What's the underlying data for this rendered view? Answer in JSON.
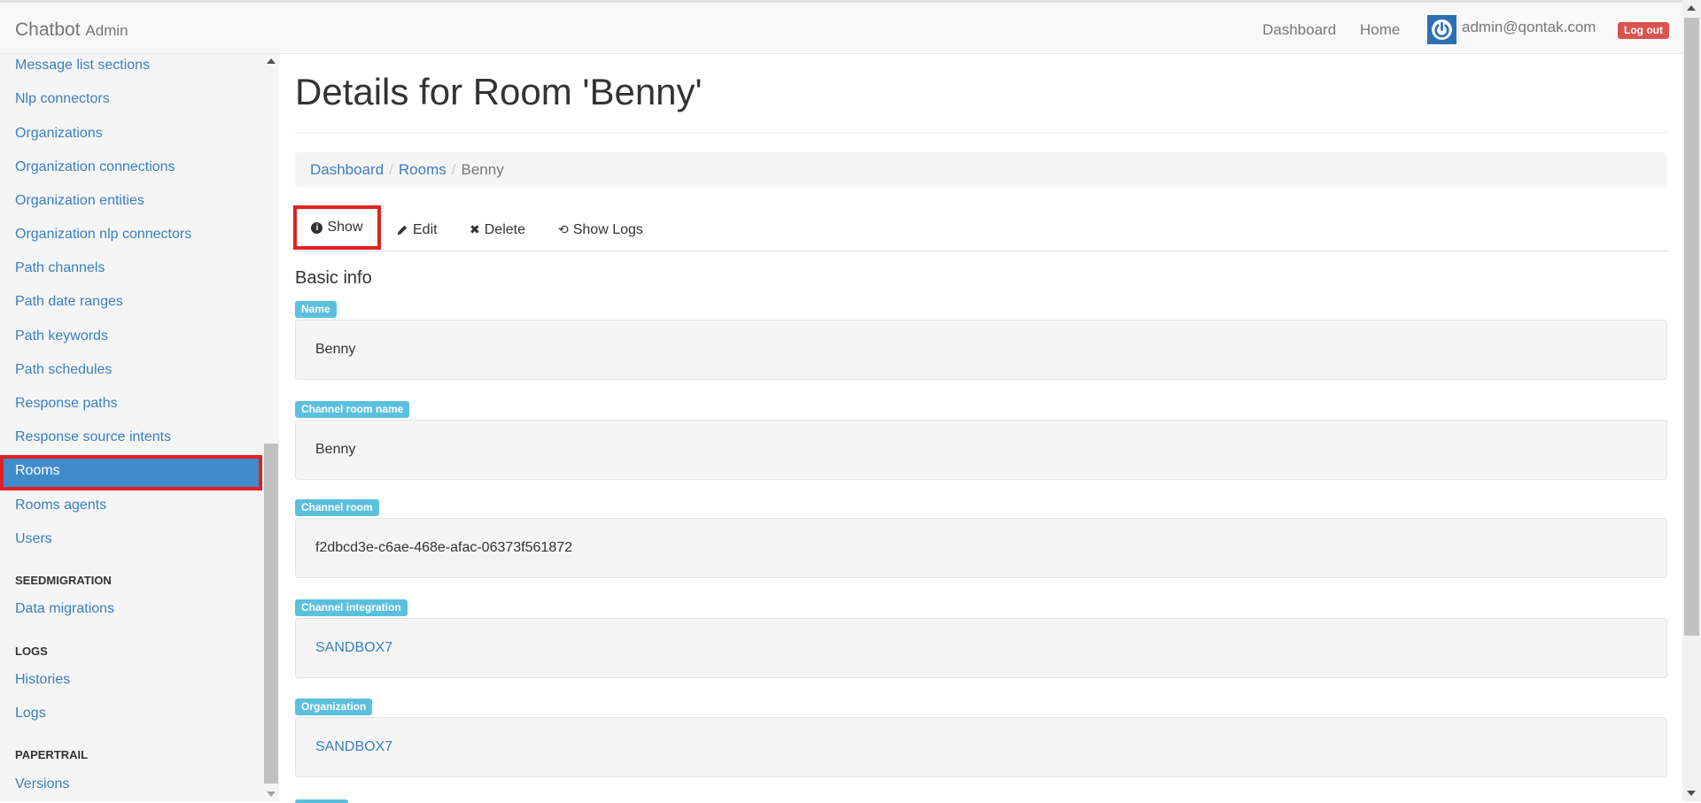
{
  "navbar": {
    "brand": "Chatbot",
    "brand_sub": "Admin",
    "links": [
      "Dashboard",
      "Home"
    ],
    "user_email": "admin@qontak.com",
    "logout_label": "Log out"
  },
  "sidebar": {
    "items": [
      {
        "label": "Message list sections"
      },
      {
        "label": "Nlp connectors"
      },
      {
        "label": "Organizations"
      },
      {
        "label": "Organization connections"
      },
      {
        "label": "Organization entities"
      },
      {
        "label": "Organization nlp connectors"
      },
      {
        "label": "Path channels"
      },
      {
        "label": "Path date ranges"
      },
      {
        "label": "Path keywords"
      },
      {
        "label": "Path schedules"
      },
      {
        "label": "Response paths"
      },
      {
        "label": "Response source intents"
      },
      {
        "label": "Rooms",
        "active": true
      },
      {
        "label": "Rooms agents"
      },
      {
        "label": "Users"
      }
    ],
    "sections": [
      {
        "header": "SEEDMIGRATION",
        "items": [
          "Data migrations"
        ]
      },
      {
        "header": "LOGS",
        "items": [
          "Histories",
          "Logs"
        ]
      },
      {
        "header": "PAPERTRAIL",
        "items": [
          "Versions"
        ]
      }
    ]
  },
  "main": {
    "title": "Details for Room 'Benny'",
    "breadcrumb": [
      "Dashboard",
      "Rooms",
      "Benny"
    ],
    "tabs": [
      {
        "label": "Show",
        "icon": "info-icon",
        "active": true
      },
      {
        "label": "Edit",
        "icon": "pencil-icon"
      },
      {
        "label": "Delete",
        "icon": "close-icon"
      },
      {
        "label": "Show Logs",
        "icon": "history-icon"
      }
    ],
    "section_title": "Basic info",
    "fields": [
      {
        "label": "Name",
        "value": "Benny",
        "link": false
      },
      {
        "label": "Channel room name",
        "value": "Benny",
        "link": false
      },
      {
        "label": "Channel room",
        "value": "f2dbcd3e-c6ae-468e-afac-06373f561872",
        "link": false
      },
      {
        "label": "Channel integration",
        "value": "SANDBOX7",
        "link": true
      },
      {
        "label": "Organization",
        "value": "SANDBOX7",
        "link": true
      }
    ]
  },
  "colors": {
    "accent": "#428bca",
    "highlight": "#e02020",
    "label": "#5bc0de",
    "danger": "#d9534f"
  }
}
